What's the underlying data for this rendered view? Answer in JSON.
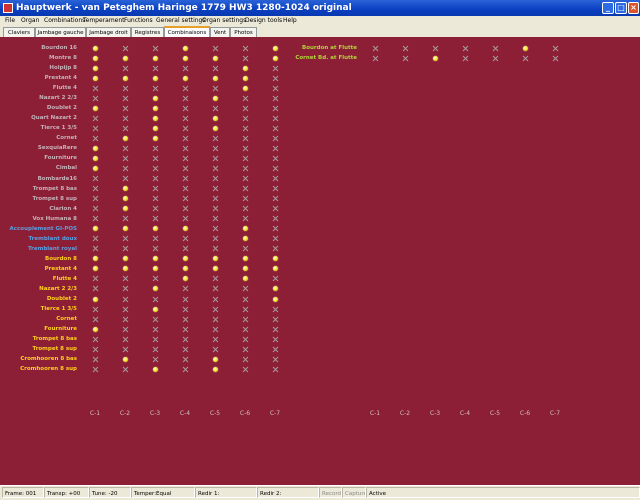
{
  "window": {
    "title": "Hauptwerk - van Peteghem Haringe 1779 HW3 1280-1024 original",
    "controls": [
      "minimize-icon",
      "maximize-icon",
      "close-icon"
    ]
  },
  "menu": [
    "File",
    "Organ",
    "Combinations",
    "Temperament",
    "Functions",
    "General settings",
    "Organ settings",
    "Design tools",
    "Help"
  ],
  "tabs": [
    "Claviers",
    "Jambage gauche",
    "Jambage droit",
    "Registres",
    "Combinaisons",
    "Vent",
    "Photos"
  ],
  "active_tab": "Combinaisons",
  "colors": {
    "background": "#8c1f36",
    "grey_label": "#c4b3b9",
    "blue_label": "#5a9ee0",
    "yellow_label": "#ffd21a",
    "green_label": "#b4d43a",
    "led_on": "#f7e420"
  },
  "left_panel": {
    "columns": [
      "C-1",
      "C-2",
      "C-3",
      "C-4",
      "C-5",
      "C-6",
      "C-7"
    ],
    "rows": [
      {
        "label": "Bourdon 16",
        "color": "grey",
        "on": [
          1,
          0,
          0,
          1,
          0,
          0,
          1
        ]
      },
      {
        "label": "Montre 8",
        "color": "grey",
        "on": [
          1,
          1,
          1,
          1,
          1,
          0,
          1
        ]
      },
      {
        "label": "Holpijp 8",
        "color": "grey",
        "on": [
          1,
          0,
          0,
          0,
          0,
          1,
          0
        ]
      },
      {
        "label": "Prestant 4",
        "color": "grey",
        "on": [
          1,
          1,
          1,
          1,
          1,
          1,
          0
        ]
      },
      {
        "label": "Flutte 4",
        "color": "grey",
        "on": [
          0,
          0,
          0,
          0,
          0,
          1,
          0
        ]
      },
      {
        "label": "Nazart 2 2/3",
        "color": "grey",
        "on": [
          0,
          0,
          1,
          0,
          1,
          0,
          0
        ]
      },
      {
        "label": "Doublet 2",
        "color": "grey",
        "on": [
          1,
          0,
          1,
          0,
          0,
          0,
          0
        ]
      },
      {
        "label": "Quart Nazart 2",
        "color": "grey",
        "on": [
          0,
          0,
          1,
          0,
          1,
          0,
          0
        ]
      },
      {
        "label": "Tierce 1 3/5",
        "color": "grey",
        "on": [
          0,
          0,
          1,
          0,
          1,
          0,
          0
        ]
      },
      {
        "label": "Cornet",
        "color": "grey",
        "on": [
          0,
          1,
          1,
          0,
          0,
          0,
          0
        ]
      },
      {
        "label": "SexquiaRere",
        "color": "grey",
        "on": [
          1,
          0,
          0,
          0,
          0,
          0,
          0
        ]
      },
      {
        "label": "Fourniture",
        "color": "grey",
        "on": [
          1,
          0,
          0,
          0,
          0,
          0,
          0
        ]
      },
      {
        "label": "Cimbal",
        "color": "grey",
        "on": [
          1,
          0,
          0,
          0,
          0,
          0,
          0
        ]
      },
      {
        "label": "Bombarde16",
        "color": "grey",
        "on": [
          0,
          0,
          0,
          0,
          0,
          0,
          0
        ]
      },
      {
        "label": "Trompet 8 bas",
        "color": "grey",
        "on": [
          0,
          1,
          0,
          0,
          0,
          0,
          0
        ]
      },
      {
        "label": "Trompet 8 sup",
        "color": "grey",
        "on": [
          0,
          1,
          0,
          0,
          0,
          0,
          0
        ]
      },
      {
        "label": "Clarion 4",
        "color": "grey",
        "on": [
          0,
          1,
          0,
          0,
          0,
          0,
          0
        ]
      },
      {
        "label": "Vox Humana 8",
        "color": "grey",
        "on": [
          0,
          0,
          0,
          0,
          0,
          0,
          0
        ]
      },
      {
        "label": "Accouplement GI-POS",
        "color": "blue",
        "on": [
          1,
          1,
          1,
          1,
          0,
          1,
          0
        ]
      },
      {
        "label": "Tremblant doux",
        "color": "blue",
        "on": [
          0,
          0,
          0,
          0,
          0,
          1,
          0
        ]
      },
      {
        "label": "Tremblant royal",
        "color": "blue",
        "on": [
          0,
          0,
          0,
          0,
          0,
          0,
          0
        ]
      },
      {
        "label": "Bourdon 8",
        "color": "yellow",
        "on": [
          1,
          1,
          1,
          1,
          1,
          1,
          1
        ]
      },
      {
        "label": "Prestant 4",
        "color": "yellow",
        "on": [
          1,
          1,
          1,
          1,
          1,
          1,
          1
        ]
      },
      {
        "label": "Flutte 4",
        "color": "yellow",
        "on": [
          0,
          0,
          0,
          1,
          0,
          1,
          0
        ]
      },
      {
        "label": "Nazart 2 2/3",
        "color": "yellow",
        "on": [
          0,
          0,
          1,
          0,
          0,
          0,
          1
        ]
      },
      {
        "label": "Doublet 2",
        "color": "yellow",
        "on": [
          1,
          0,
          0,
          0,
          0,
          0,
          1
        ]
      },
      {
        "label": "Tierce 1 3/5",
        "color": "yellow",
        "on": [
          0,
          0,
          1,
          0,
          0,
          0,
          0
        ]
      },
      {
        "label": "Cornet",
        "color": "yellow",
        "on": [
          0,
          0,
          0,
          0,
          0,
          0,
          0
        ]
      },
      {
        "label": "Fourniture",
        "color": "yellow",
        "on": [
          1,
          0,
          0,
          0,
          0,
          0,
          0
        ]
      },
      {
        "label": "Trompet 8 bas",
        "color": "yellow",
        "on": [
          0,
          0,
          0,
          0,
          0,
          0,
          0
        ]
      },
      {
        "label": "Trompet 8 sup",
        "color": "yellow",
        "on": [
          0,
          0,
          0,
          0,
          0,
          0,
          0
        ]
      },
      {
        "label": "Cromhooren 8 bas",
        "color": "yellow",
        "on": [
          0,
          1,
          0,
          0,
          1,
          0,
          0
        ]
      },
      {
        "label": "Cromhooren 8 sup",
        "color": "yellow",
        "on": [
          0,
          0,
          1,
          0,
          1,
          0,
          0
        ]
      }
    ]
  },
  "right_panel": {
    "columns": [
      "C-1",
      "C-2",
      "C-3",
      "C-4",
      "C-5",
      "C-6",
      "C-7"
    ],
    "rows": [
      {
        "label": "Bourdon at Flutte",
        "color": "green",
        "on": [
          0,
          0,
          0,
          0,
          0,
          1,
          0
        ]
      },
      {
        "label": "Cornet Bd. at Flutte",
        "color": "green",
        "on": [
          0,
          0,
          1,
          0,
          0,
          0,
          0
        ]
      }
    ]
  },
  "status": {
    "frame": "Frame: 001",
    "transp": "Transp: +00",
    "tune": "Tune: -20",
    "temper": "Temper:Equal",
    "redir1": "Redir 1:",
    "redir2": "Redir 2:",
    "record": "Record",
    "capture": "Capture",
    "active": "Active"
  }
}
